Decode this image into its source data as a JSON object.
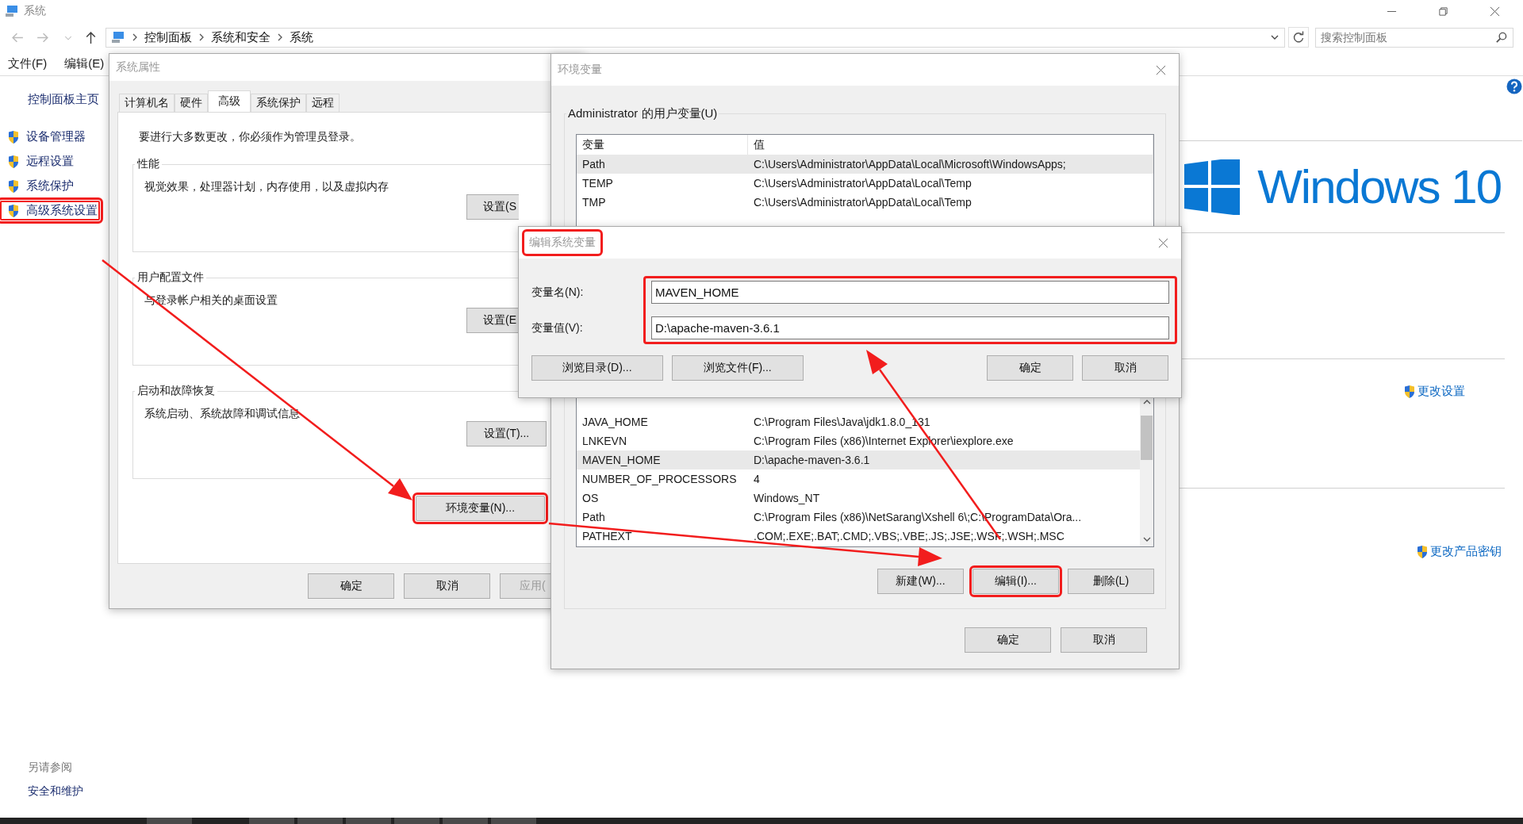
{
  "window": {
    "title": "系统",
    "breadcrumb": [
      "控制面板",
      "系统和安全",
      "系统"
    ],
    "search_placeholder": "搜索控制面板"
  },
  "menu": [
    "文件(F)",
    "编辑(E)"
  ],
  "sidebar": {
    "home": "控制面板主页",
    "items": [
      {
        "label": "设备管理器",
        "highlighted": false
      },
      {
        "label": "远程设置",
        "highlighted": false
      },
      {
        "label": "系统保护",
        "highlighted": false
      },
      {
        "label": "高级系统设置",
        "highlighted": true
      }
    ],
    "see_also_title": "另请参阅",
    "see_also": [
      "安全和维护"
    ]
  },
  "main": {
    "logo_text": "Windows 10",
    "links": [
      "更改设置",
      "更改产品密钥"
    ]
  },
  "system_properties": {
    "title": "系统属性",
    "tabs": [
      {
        "label": "计算机名",
        "selected": false
      },
      {
        "label": "硬件",
        "selected": false
      },
      {
        "label": "高级",
        "selected": true
      },
      {
        "label": "系统保护",
        "selected": false
      },
      {
        "label": "远程",
        "selected": false
      }
    ],
    "notice": "要进行大多数更改，你必须作为管理员登录。",
    "groups": [
      {
        "title": "性能",
        "description": "视觉效果，处理器计划，内存使用，以及虚拟内存",
        "button": "设置(S",
        "cut": true
      },
      {
        "title": "用户配置文件",
        "description": "与登录帐户相关的桌面设置",
        "button": "设置(E",
        "cut": true
      },
      {
        "title": "启动和故障恢复",
        "description": "系统启动、系统故障和调试信息",
        "button": "设置(T)...",
        "cut": false
      }
    ],
    "env_button": {
      "label": "环境变量(N)...",
      "highlighted": true
    },
    "buttons": [
      {
        "label": "确定",
        "disabled": false
      },
      {
        "label": "取消",
        "disabled": false
      },
      {
        "label": "应用(",
        "disabled": true
      }
    ]
  },
  "environment_variables": {
    "title": "环境变量",
    "user_group": "Administrator 的用户变量(U)",
    "columns": [
      "变量",
      "值"
    ],
    "user_rows": [
      {
        "name": "Path",
        "value": "C:\\Users\\Administrator\\AppData\\Local\\Microsoft\\WindowsApps;",
        "selected": true
      },
      {
        "name": "TEMP",
        "value": "C:\\Users\\Administrator\\AppData\\Local\\Temp",
        "selected": false
      },
      {
        "name": "TMP",
        "value": "C:\\Users\\Administrator\\AppData\\Local\\Temp",
        "selected": false
      }
    ],
    "system_rows": [
      {
        "name": "JAVA_HOME",
        "value": "C:\\Program Files\\Java\\jdk1.8.0_131",
        "selected": false
      },
      {
        "name": "LNKEVN",
        "value": "C:\\Program Files (x86)\\Internet Explorer\\iexplore.exe",
        "selected": false
      },
      {
        "name": "MAVEN_HOME",
        "value": "D:\\apache-maven-3.6.1",
        "selected": true
      },
      {
        "name": "NUMBER_OF_PROCESSORS",
        "value": "4",
        "selected": false
      },
      {
        "name": "OS",
        "value": "Windows_NT",
        "selected": false
      },
      {
        "name": "Path",
        "value": "C:\\Program Files (x86)\\NetSarang\\Xshell 6\\;C:\\ProgramData\\Ora...",
        "selected": false
      },
      {
        "name": "PATHEXT",
        "value": ".COM;.EXE;.BAT;.CMD;.VBS;.VBE;.JS;.JSE;.WSF;.WSH;.MSC",
        "selected": false
      }
    ],
    "system_buttons": [
      {
        "label": "新建(W)...",
        "highlighted": false
      },
      {
        "label": "编辑(I)...",
        "highlighted": true
      },
      {
        "label": "删除(L)",
        "highlighted": false
      }
    ],
    "buttons": [
      "确定",
      "取消"
    ]
  },
  "edit_dialog": {
    "title": "编辑系统变量",
    "title_highlighted": true,
    "fields_highlighted": true,
    "fields": [
      {
        "label": "变量名(N):",
        "value": "MAVEN_HOME"
      },
      {
        "label": "变量值(V):",
        "value": "D:\\apache-maven-3.6.1"
      }
    ],
    "left_buttons": [
      "浏览目录(D)...",
      "浏览文件(F)..."
    ],
    "right_buttons": [
      "确定",
      "取消"
    ]
  }
}
